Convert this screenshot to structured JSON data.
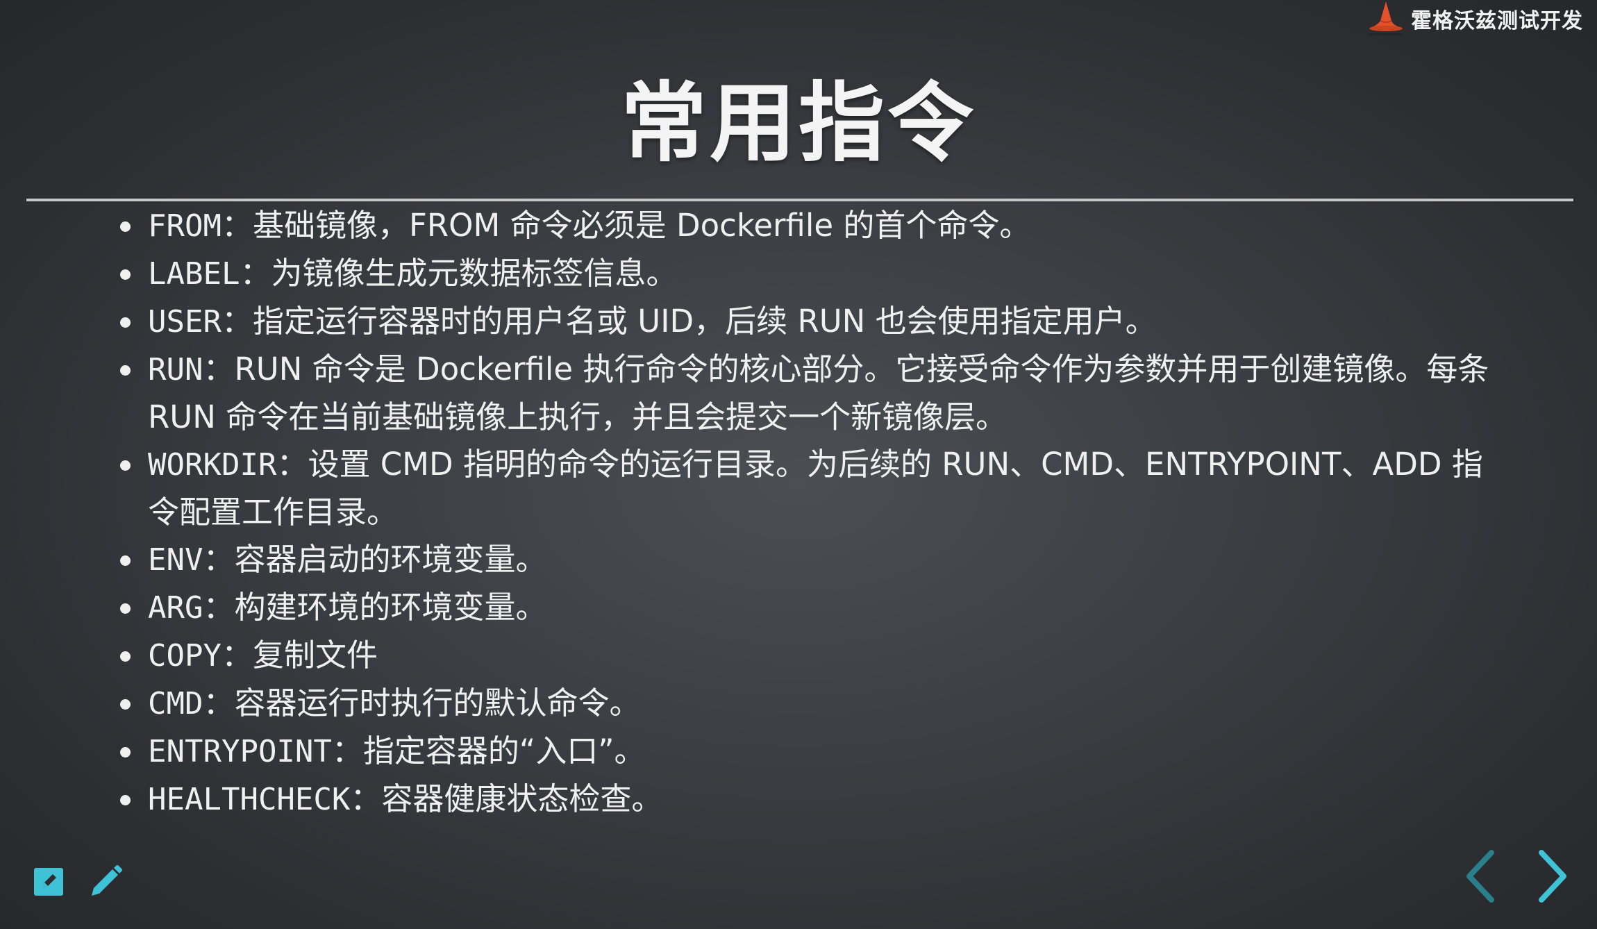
{
  "brand": {
    "name": "霍格沃兹测试开发",
    "icon": "wizard-hat-icon"
  },
  "slide": {
    "title": "常用指令",
    "items": [
      {
        "keyword": "FROM",
        "text": "：基础镜像，FROM 命令必须是 Dockerfile 的首个命令。"
      },
      {
        "keyword": "LABEL",
        "text": "：为镜像生成元数据标签信息。"
      },
      {
        "keyword": "USER",
        "text": "：指定运行容器时的用户名或 UID，后续 RUN 也会使用指定用户。"
      },
      {
        "keyword": "RUN",
        "text": "：RUN 命令是 Dockerfile 执行命令的核心部分。它接受命令作为参数并用于创建镜像。每条 RUN 命令在当前基础镜像上执行，并且会提交一个新镜像层。"
      },
      {
        "keyword": "WORKDIR",
        "text": "：设置 CMD 指明的命令的运行目录。为后续的 RUN、CMD、ENTRYPOINT、ADD 指令配置工作目录。"
      },
      {
        "keyword": "ENV",
        "text": "：容器启动的环境变量。"
      },
      {
        "keyword": "ARG",
        "text": "：构建环境的环境变量。"
      },
      {
        "keyword": "COPY",
        "text": "：复制文件"
      },
      {
        "keyword": "CMD",
        "text": "：容器运行时执行的默认命令。"
      },
      {
        "keyword": "ENTRYPOINT",
        "text": "：指定容器的“入口”。"
      },
      {
        "keyword": "HEALTHCHECK",
        "text": "：容器健康状态检查。"
      }
    ]
  },
  "toolbar": {
    "edit_icon": "edit-icon",
    "pen_icon": "pen-icon"
  },
  "navigation": {
    "prev_icon": "chevron-left-icon",
    "next_icon": "chevron-right-icon"
  },
  "colors": {
    "accent": "#3fc1d6",
    "accent_dim": "#2a7f8d",
    "title": "#f4f4f4",
    "rule": "#c6c6c6"
  }
}
